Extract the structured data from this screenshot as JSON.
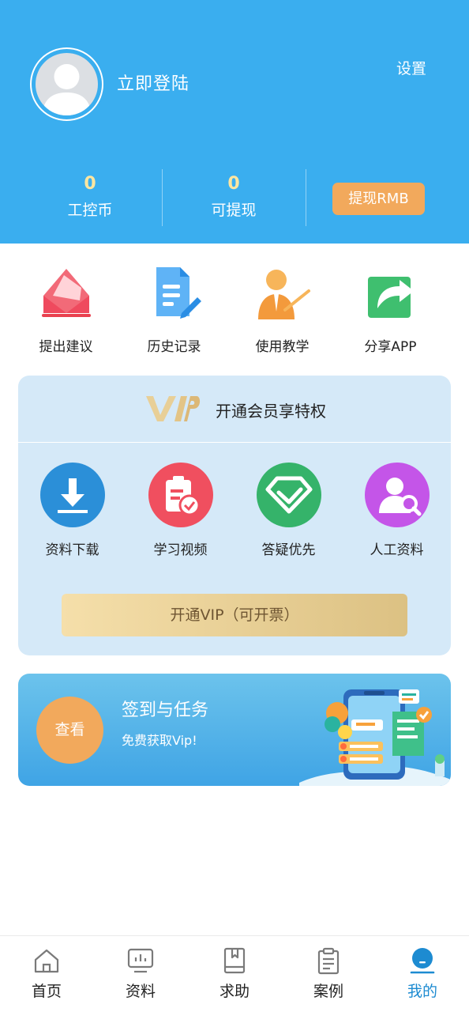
{
  "header": {
    "login_text": "立即登陆",
    "settings_label": "设置",
    "stats": [
      {
        "value": "0",
        "label": "工控币"
      },
      {
        "value": "0",
        "label": "可提现"
      }
    ],
    "withdraw_button": "提现RMB",
    "background_color": "#3aaeef"
  },
  "quick_actions": [
    {
      "label": "提出建议",
      "icon": "envelope-icon"
    },
    {
      "label": "历史记录",
      "icon": "document-edit-icon"
    },
    {
      "label": "使用教学",
      "icon": "teacher-icon"
    },
    {
      "label": "分享APP",
      "icon": "share-arrow-icon"
    }
  ],
  "vip": {
    "logo_text": "VIP",
    "headline": "开通会员享特权",
    "benefits": [
      {
        "label": "资料下载",
        "icon": "download-icon",
        "color": "#2b8fd8"
      },
      {
        "label": "学习视频",
        "icon": "clipboard-check-icon",
        "color": "#f04f5f"
      },
      {
        "label": "答疑优先",
        "icon": "diamond-icon",
        "color": "#35b36a"
      },
      {
        "label": "人工资料",
        "icon": "user-search-icon",
        "color": "#c455e8"
      }
    ],
    "cta_button": "开通VIP（可开票）"
  },
  "task_banner": {
    "button_label": "查看",
    "title": "签到与任务",
    "subtitle": "免费获取Vip!"
  },
  "bottom_nav": {
    "active_index": 4,
    "active_color": "#1d8bd1",
    "items": [
      {
        "label": "首页",
        "icon": "home-icon"
      },
      {
        "label": "资料",
        "icon": "chart-board-icon"
      },
      {
        "label": "求助",
        "icon": "book-bookmark-icon"
      },
      {
        "label": "案例",
        "icon": "clipboard-icon"
      },
      {
        "label": "我的",
        "icon": "profile-icon"
      }
    ]
  }
}
